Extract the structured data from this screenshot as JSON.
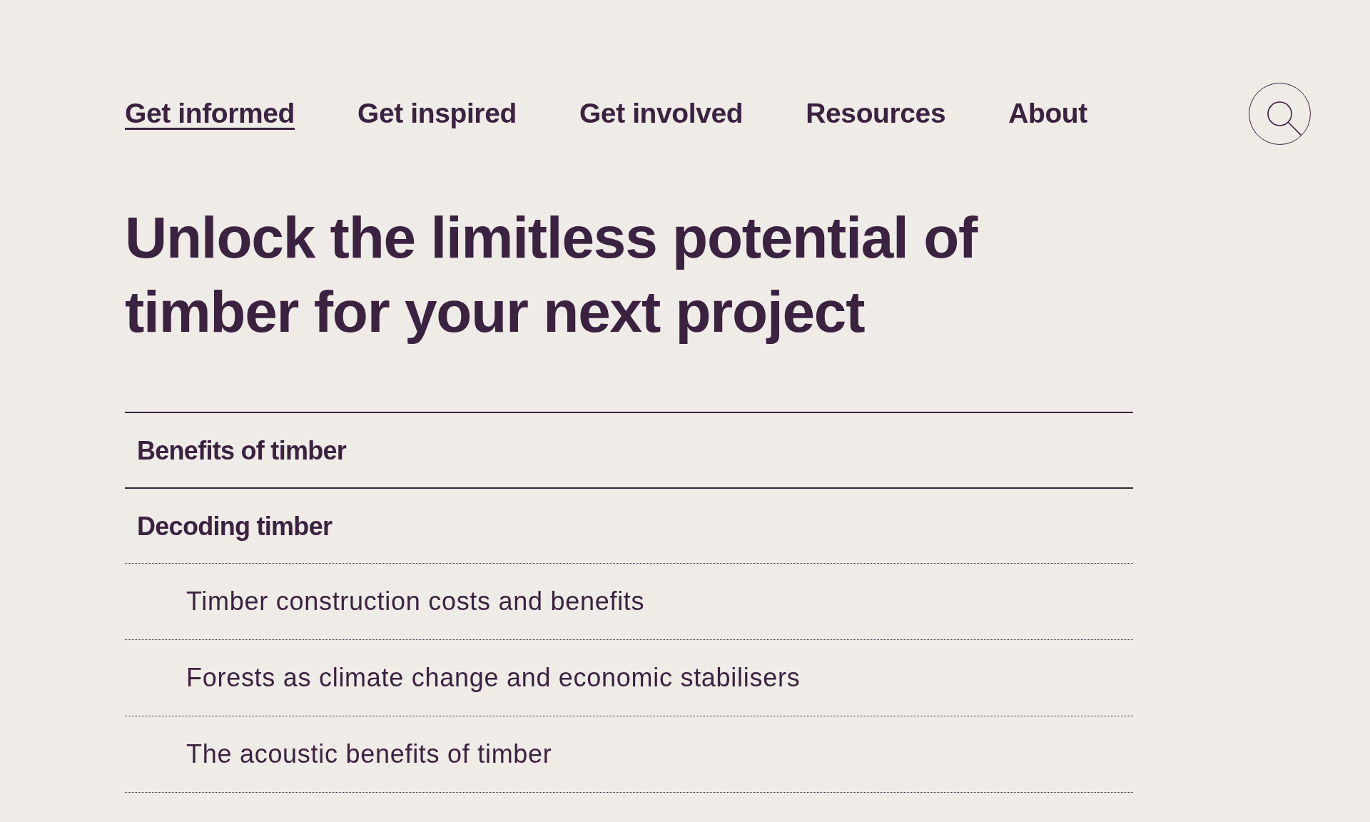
{
  "nav": {
    "items": [
      {
        "label": "Get informed",
        "selected": true
      },
      {
        "label": "Get inspired",
        "selected": false
      },
      {
        "label": "Get involved",
        "selected": false
      },
      {
        "label": "Resources",
        "selected": false
      },
      {
        "label": "About",
        "selected": false
      }
    ]
  },
  "heading": "Unlock the limitless potential of timber for your next project",
  "menu": {
    "sections": [
      {
        "label": "Benefits of timber"
      },
      {
        "label": "Decoding timber",
        "children": [
          {
            "label": "Timber construction costs and benefits"
          },
          {
            "label": "Forests as climate change and economic stabilisers"
          },
          {
            "label": "The acoustic benefits of timber"
          }
        ]
      }
    ]
  }
}
